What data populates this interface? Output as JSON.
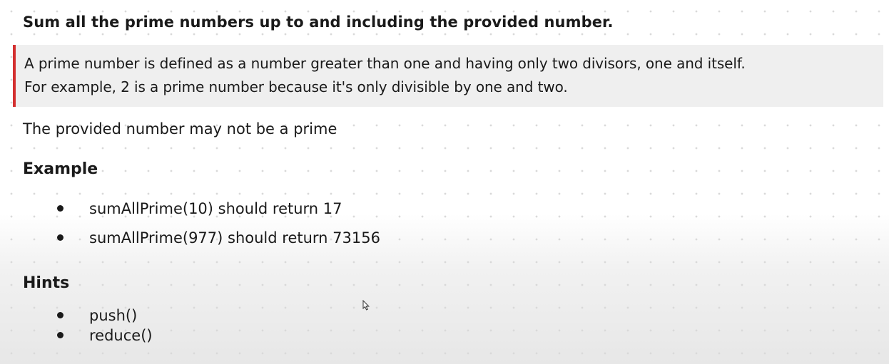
{
  "title": "Sum all the prime numbers up to and including the provided number.",
  "callout": {
    "line1": "A prime number is defined as a number greater than one and having only two divisors, one and itself.",
    "line2": "For example, 2 is a prime number because it's only divisible by one and two.",
    "accent_color": "#d32f2f"
  },
  "note": "The provided number may not be a prime",
  "example": {
    "heading": "Example",
    "items": [
      "sumAllPrime(10) should return 17",
      "sumAllPrime(977) should return 73156"
    ]
  },
  "hints": {
    "heading": "Hints",
    "items": [
      "push()",
      "reduce()"
    ]
  },
  "cursor_icon": "mouse-pointer-icon"
}
